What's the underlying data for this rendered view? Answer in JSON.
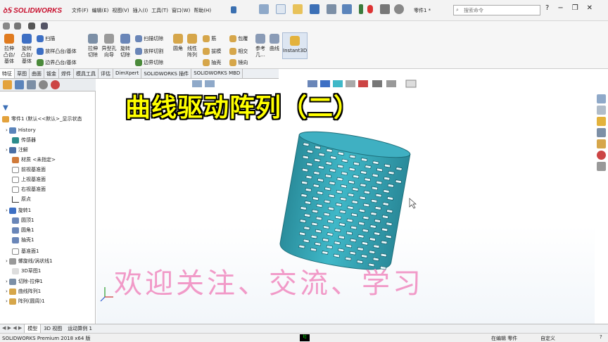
{
  "app": {
    "logo": "SOLIDWORKS",
    "document": "零件1 *",
    "search_placeholder": "搜索命令"
  },
  "menu": [
    "文件(F)",
    "编辑(E)",
    "视图(V)",
    "插入(I)",
    "工具(T)",
    "窗口(W)",
    "帮助(H)"
  ],
  "ribbon": {
    "extrude_boss": "拉伸\n凸台/\n基体",
    "revolve_boss": "旋转\n凸台/\n基体",
    "sweep": "扫描",
    "loft": "放样凸台/基体",
    "boundary": "边界凸台/基体",
    "extrude_cut": "拉伸\n切除",
    "hole_wizard": "异型孔\n向导",
    "revolve_cut": "旋转\n切除",
    "sweep_cut": "扫描切除",
    "loft_cut": "放样切割",
    "boundary_cut": "边界切除",
    "fillet": "圆角",
    "linear_pattern": "线性\n阵列",
    "rib": "筋",
    "draft": "拔模",
    "shell": "抽壳",
    "wrap": "包覆",
    "intersect": "相交",
    "mirror": "镜向",
    "reference": "参考\n几...",
    "curves": "曲线",
    "instant3d": "Instant3D"
  },
  "tabs": [
    "特征",
    "草图",
    "曲面",
    "钣金",
    "焊件",
    "模具工具",
    "评估",
    "DimXpert",
    "SOLIDWORKS 插件",
    "SOLIDWORKS MBD"
  ],
  "tree": {
    "root": "零件1 (默认<<默认>_显示状态",
    "items": [
      "History",
      "传感器",
      "注解",
      "材质 <未指定>",
      "前视基准面",
      "上视基准面",
      "右视基准面",
      "原点",
      "旋转1",
      "圆顶1",
      "圆角1",
      "抽壳1",
      "基准面1",
      "螺旋线/涡状线1",
      "3D草图1",
      "切除-拉伸1",
      "曲线阵列1",
      "阵列(圆周)1"
    ]
  },
  "overlay": {
    "title": "曲线驱动阵列（二）",
    "slogan": "欢迎关注、交流、学习"
  },
  "bottom_tabs": [
    "模型",
    "3D 视图",
    "运动算例 1"
  ],
  "status": {
    "left": "SOLIDWORKS Premium 2018 x64 版",
    "editing": "在编辑 零件",
    "custom": "自定义"
  },
  "colors": {
    "accent": "#c8102e",
    "model": "#3fb8c8"
  }
}
